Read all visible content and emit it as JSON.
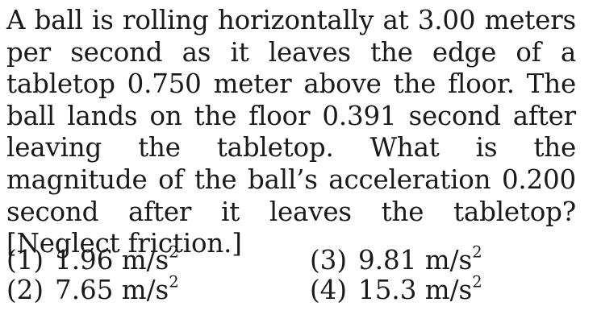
{
  "question": {
    "text": "A ball is rolling horizontally at 3.00 meters per second as it leaves the edge of a tabletop 0.750 meter above the floor. The ball lands on the floor 0.391 second after leaving the tabletop. What is the magnitude of the ball’s acceleration 0.200 second after it leaves the tabletop? [Neglect friction.]"
  },
  "choices": [
    {
      "number": "(1)",
      "value": "1.96",
      "unit": "m/s",
      "exponent": "2"
    },
    {
      "number": "(2)",
      "value": "7.65",
      "unit": "m/s",
      "exponent": "2"
    },
    {
      "number": "(3)",
      "value": "9.81",
      "unit": "m/s",
      "exponent": "2"
    },
    {
      "number": "(4)",
      "value": "15.3",
      "unit": "m/s",
      "exponent": "2"
    }
  ]
}
